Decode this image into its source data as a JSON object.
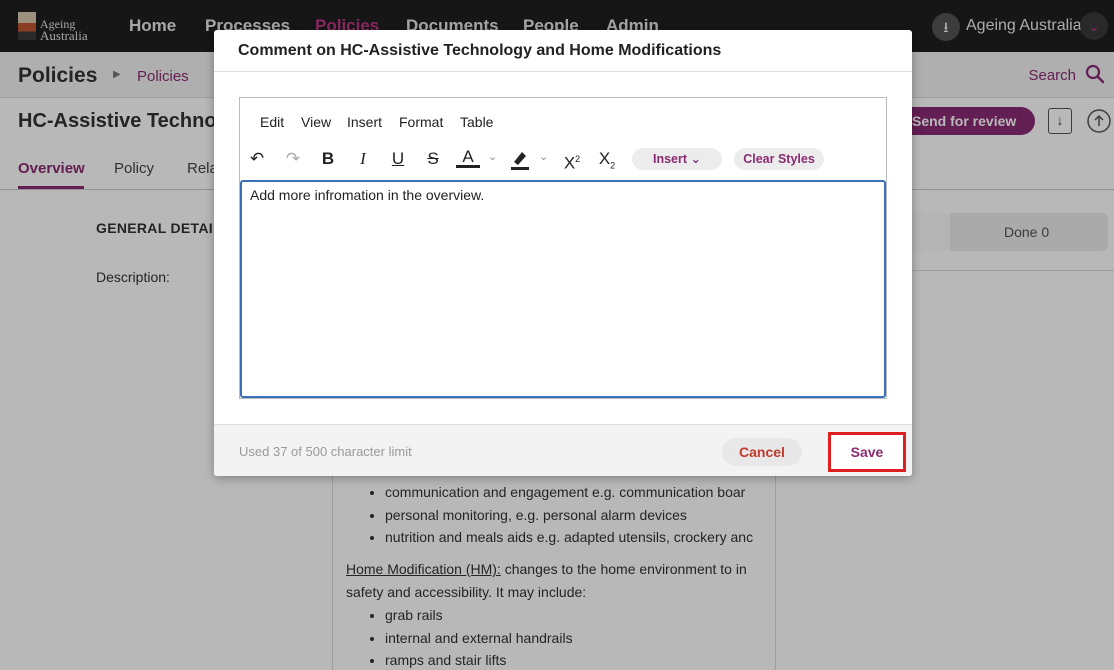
{
  "app": {
    "logo_line1": "Ageing",
    "logo_line2": "Australia",
    "nav": [
      "Home",
      "Processes",
      "Policies",
      "Documents",
      "People",
      "Admin"
    ],
    "active_nav": "Policies",
    "user_name": "Ageing Australia"
  },
  "breadcrumb": {
    "title": "Policies",
    "link": "Policies",
    "search_label": "Search"
  },
  "document": {
    "title": "HC-Assistive Techno",
    "send_label": "Send for review",
    "tabs": [
      "Overview",
      "Policy",
      "Rela"
    ],
    "general_details": "GENERAL DETAIL",
    "description_label": "Description:",
    "list1": [
      "communication and engagement e.g. communication boar",
      "personal monitoring, e.g. personal alarm devices",
      "nutrition and meals aids e.g. adapted utensils, crockery anc"
    ],
    "hm_heading": "Home Modification (HM):",
    "hm_text": " changes to the home environment to in",
    "hm_text2": "safety and accessibility. It may include:",
    "list2": [
      "grab rails",
      "internal and external handrails",
      "ramps and stair lifts"
    ]
  },
  "side": {
    "done_label": "Done 0"
  },
  "modal": {
    "title": "Comment on HC-Assistive Technology and Home Modifications",
    "menu": [
      "Edit",
      "View",
      "Insert",
      "Format",
      "Table"
    ],
    "insert_pill": "Insert",
    "clear_styles": "Clear Styles",
    "content": "Add more infromation in the overview.",
    "char_count": "Used 37 of 500 character limit",
    "cancel_label": "Cancel",
    "save_label": "Save"
  },
  "colors": {
    "brand": "#8a2b73",
    "nav_bg": "#1f1f1f",
    "focus_border": "#3b6fb6",
    "highlight_box": "#e02020",
    "cancel_text": "#c0392b"
  }
}
